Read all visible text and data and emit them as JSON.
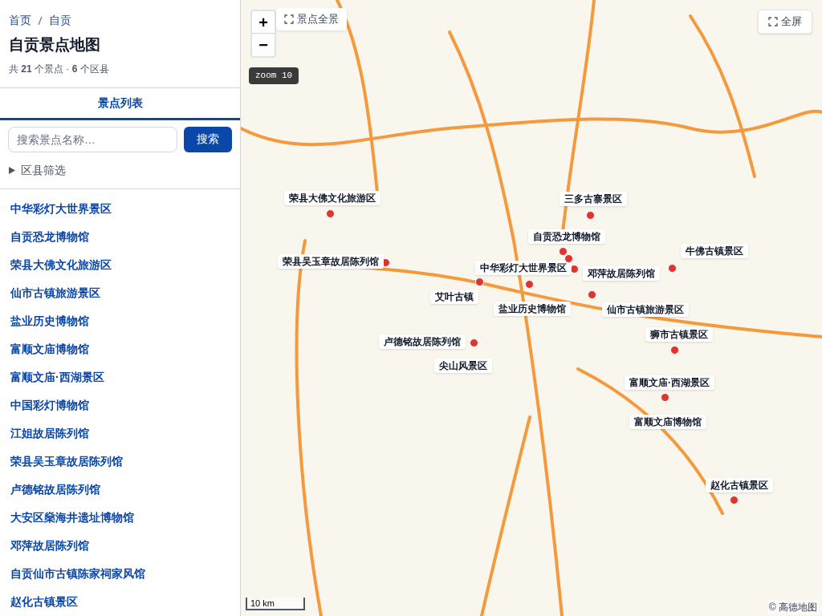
{
  "breadcrumb": [
    {
      "label": "首页"
    },
    {
      "label": "自贡"
    }
  ],
  "title": "自贡景点地图",
  "stats": "共 **21** 个景点 · **6** 个区县",
  "tabs": [
    {
      "label": "景点列表",
      "selected": true
    }
  ],
  "search": {
    "placeholder": "搜索景点名称…",
    "button": "搜索"
  },
  "filter": {
    "label": "区县筛选",
    "expanded": false
  },
  "spots": [
    "中华彩灯大世界景区",
    "自贡恐龙博物馆",
    "荣县大佛文化旅游区",
    "仙市古镇旅游景区",
    "盐业历史博物馆",
    "富顺文庙博物馆",
    "富顺文庙·西湖景区",
    "中国彩灯博物馆",
    "江姐故居陈列馆",
    "荣县吴玉章故居陈列馆",
    "卢德铭故居陈列馆",
    "大安区燊海井遗址博物馆",
    "邓萍故居陈列馆",
    "自贡仙市古镇陈家祠家风馆",
    "赵化古镇景区"
  ],
  "map": {
    "zoom_in": "+",
    "zoom_out": "−",
    "overview_button": "景点全景",
    "fullscreen_button": "全屏",
    "zoom_badge": "zoom 10",
    "scale": "10 km",
    "attribution": "© 高德地图",
    "markers": [
      {
        "label": "荣县大佛文化旅游区"
      },
      {
        "label": "三多古寨景区"
      },
      {
        "label": "自贡恐龙博物馆"
      },
      {
        "label": "荣县吴玉章故居陈列馆"
      },
      {
        "label": "中华彩灯大世界景区"
      },
      {
        "label": "邓萍故居陈列馆"
      },
      {
        "label": "牛佛古镇景区"
      },
      {
        "label": "艾叶古镇"
      },
      {
        "label": "盐业历史博物馆"
      },
      {
        "label": "仙市古镇旅游景区"
      },
      {
        "label": "狮市古镇景区"
      },
      {
        "label": "卢德铭故居陈列馆"
      },
      {
        "label": "尖山风景区"
      },
      {
        "label": "富顺文庙·西湖景区"
      },
      {
        "label": "富顺文庙博物馆"
      },
      {
        "label": "赵化古镇景区"
      }
    ]
  }
}
